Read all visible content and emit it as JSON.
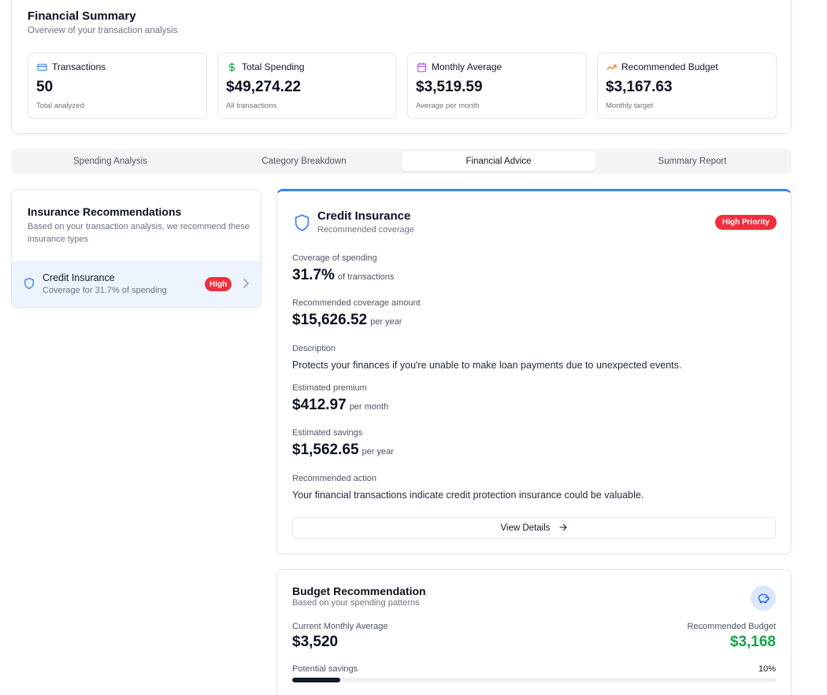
{
  "summary": {
    "title": "Financial Summary",
    "subtitle": "Overview of your transaction analysis",
    "stats": [
      {
        "label": "Transactions",
        "value": "50",
        "foot": "Total analyzed",
        "icon": "card-icon",
        "color": "#3b82f6"
      },
      {
        "label": "Total Spending",
        "value": "$49,274.22",
        "foot": "All transactions",
        "icon": "dollar-icon",
        "color": "#16a34a"
      },
      {
        "label": "Monthly Average",
        "value": "$3,519.59",
        "foot": "Average per month",
        "icon": "calendar-icon",
        "color": "#a855f7"
      },
      {
        "label": "Recommended Budget",
        "value": "$3,167.63",
        "foot": "Monthly target",
        "icon": "trending-up-icon",
        "color": "#f97316"
      }
    ]
  },
  "tabs": [
    {
      "label": "Spending Analysis",
      "active": false
    },
    {
      "label": "Category Breakdown",
      "active": false
    },
    {
      "label": "Financial Advice",
      "active": true
    },
    {
      "label": "Summary Report",
      "active": false
    }
  ],
  "insurance_list": {
    "title": "Insurance Recommendations",
    "description": "Based on your transaction analysis, we recommend these insurance types",
    "items": [
      {
        "name": "Credit Insurance",
        "coverage": "Coverage for 31.7% of spending",
        "badge": "High"
      }
    ]
  },
  "credit": {
    "title": "Credit Insurance",
    "subtitle": "Recommended coverage",
    "badge": "High Priority",
    "coverage_label": "Coverage of spending",
    "coverage_value": "31.7%",
    "coverage_unit": "of transactions",
    "amount_label": "Recommended coverage amount",
    "amount_value": "$15,626.52",
    "amount_unit": "per year",
    "description_label": "Description",
    "description": "Protects your finances if you're unable to make loan payments due to unexpected events.",
    "premium_label": "Estimated premium",
    "premium_value": "$412.97",
    "premium_unit": "per month",
    "savings_label": "Estimated savings",
    "savings_value": "$1,562.65",
    "savings_unit": "per year",
    "action_label": "Recommended action",
    "action": "Your financial transactions indicate credit protection insurance could be valuable.",
    "button": "View Details"
  },
  "budget": {
    "title": "Budget Recommendation",
    "subtitle": "Based on your spending patterns",
    "current_label": "Current Monthly Average",
    "current_value": "$3,520",
    "recommended_label": "Recommended Budget",
    "recommended_value": "$3,168",
    "savings_label": "Potential savings",
    "savings_pct": "10%",
    "savings_fraction": 0.1
  },
  "colors": {
    "accent": "#3b82f6",
    "danger": "#ef2f3c",
    "success": "#16a34a"
  }
}
